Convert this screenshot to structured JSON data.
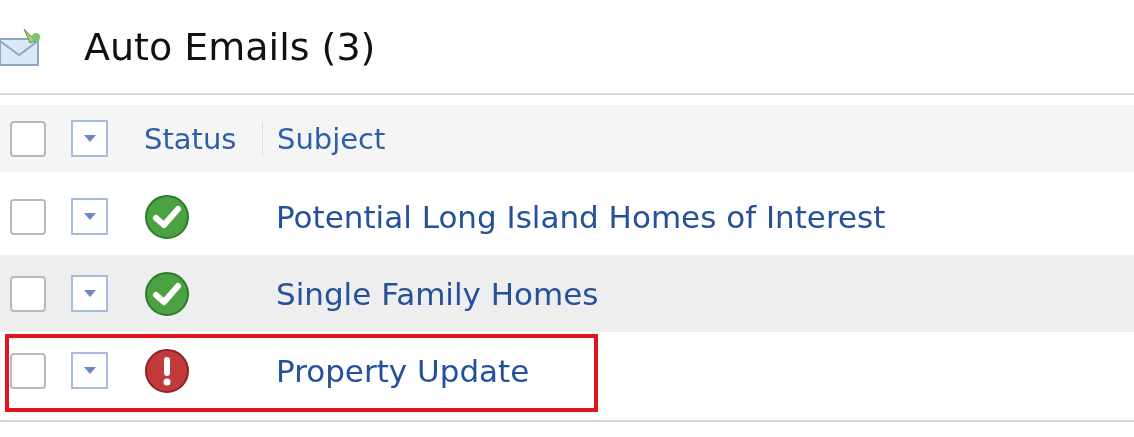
{
  "title": "Auto Emails (3)",
  "columns": [
    {
      "label": "Status"
    },
    {
      "label": "Subject"
    }
  ],
  "header_checkbox": {
    "checked": false
  },
  "rows": [
    {
      "checked": false,
      "kind": "ok",
      "subject": "Potential Long Island Homes of Interest",
      "highlighted": false
    },
    {
      "checked": false,
      "kind": "ok",
      "subject": "Single Family Homes",
      "highlighted": false
    },
    {
      "checked": false,
      "kind": "error",
      "subject": "Property Update",
      "highlighted": true
    }
  ]
}
